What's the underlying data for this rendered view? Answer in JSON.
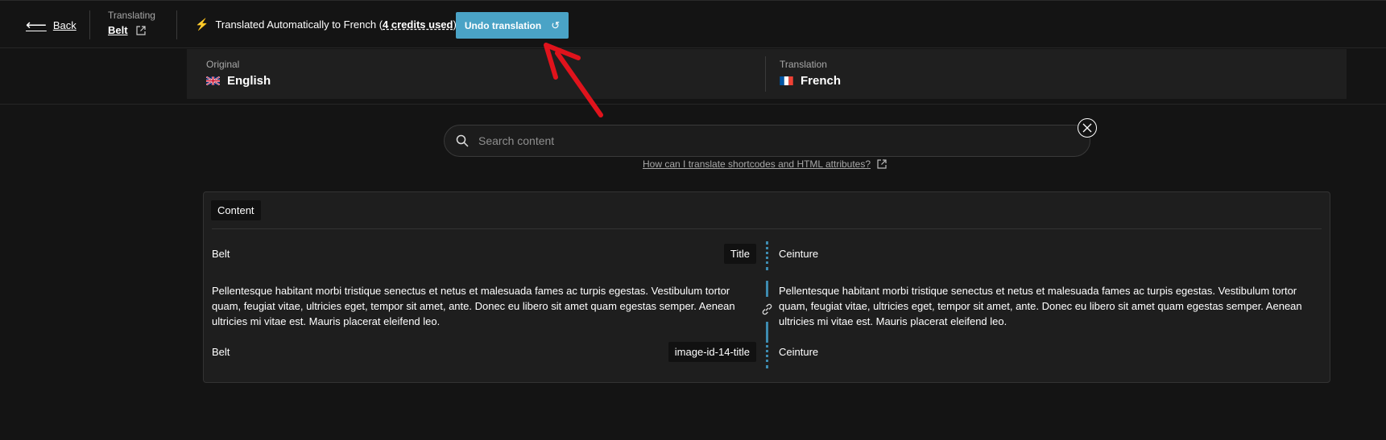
{
  "topbar": {
    "back_label": "Back",
    "translating_label": "Translating",
    "product_name": "Belt",
    "auto_prefix": "Translated Automatically to French (",
    "credits": "4 credits used",
    "auto_suffix": ")",
    "undo_label": "Undo translation"
  },
  "languages": {
    "original_caption": "Original",
    "original_name": "English",
    "translation_caption": "Translation",
    "translation_name": "French"
  },
  "search": {
    "placeholder": "Search content",
    "help_text": "How can I translate shortcodes and HTML attributes?"
  },
  "content": {
    "section_label": "Content",
    "rows": [
      {
        "original": "Belt",
        "field": "Title",
        "translation": "Ceinture"
      },
      {
        "original": "Pellentesque habitant morbi tristique senectus et netus et malesuada fames ac turpis egestas. Vestibulum tortor quam, feugiat vitae, ultricies eget, tempor sit amet, ante. Donec eu libero sit amet quam egestas semper. Aenean ultricies mi vitae est. Mauris placerat eleifend leo.",
        "field": "",
        "translation": "Pellentesque habitant morbi tristique senectus et netus et malesuada fames ac turpis egestas. Vestibulum tortor quam, feugiat vitae, ultricies eget, tempor sit amet, ante. Donec eu libero sit amet quam egestas semper. Aenean ultricies mi vitae est. Mauris placerat eleifend leo."
      },
      {
        "original": "Belt",
        "field": "image-id-14-title",
        "translation": "Ceinture"
      }
    ]
  },
  "colors": {
    "accent": "#4aa3c6",
    "annotation_arrow": "#e0131c",
    "background": "#141414"
  }
}
